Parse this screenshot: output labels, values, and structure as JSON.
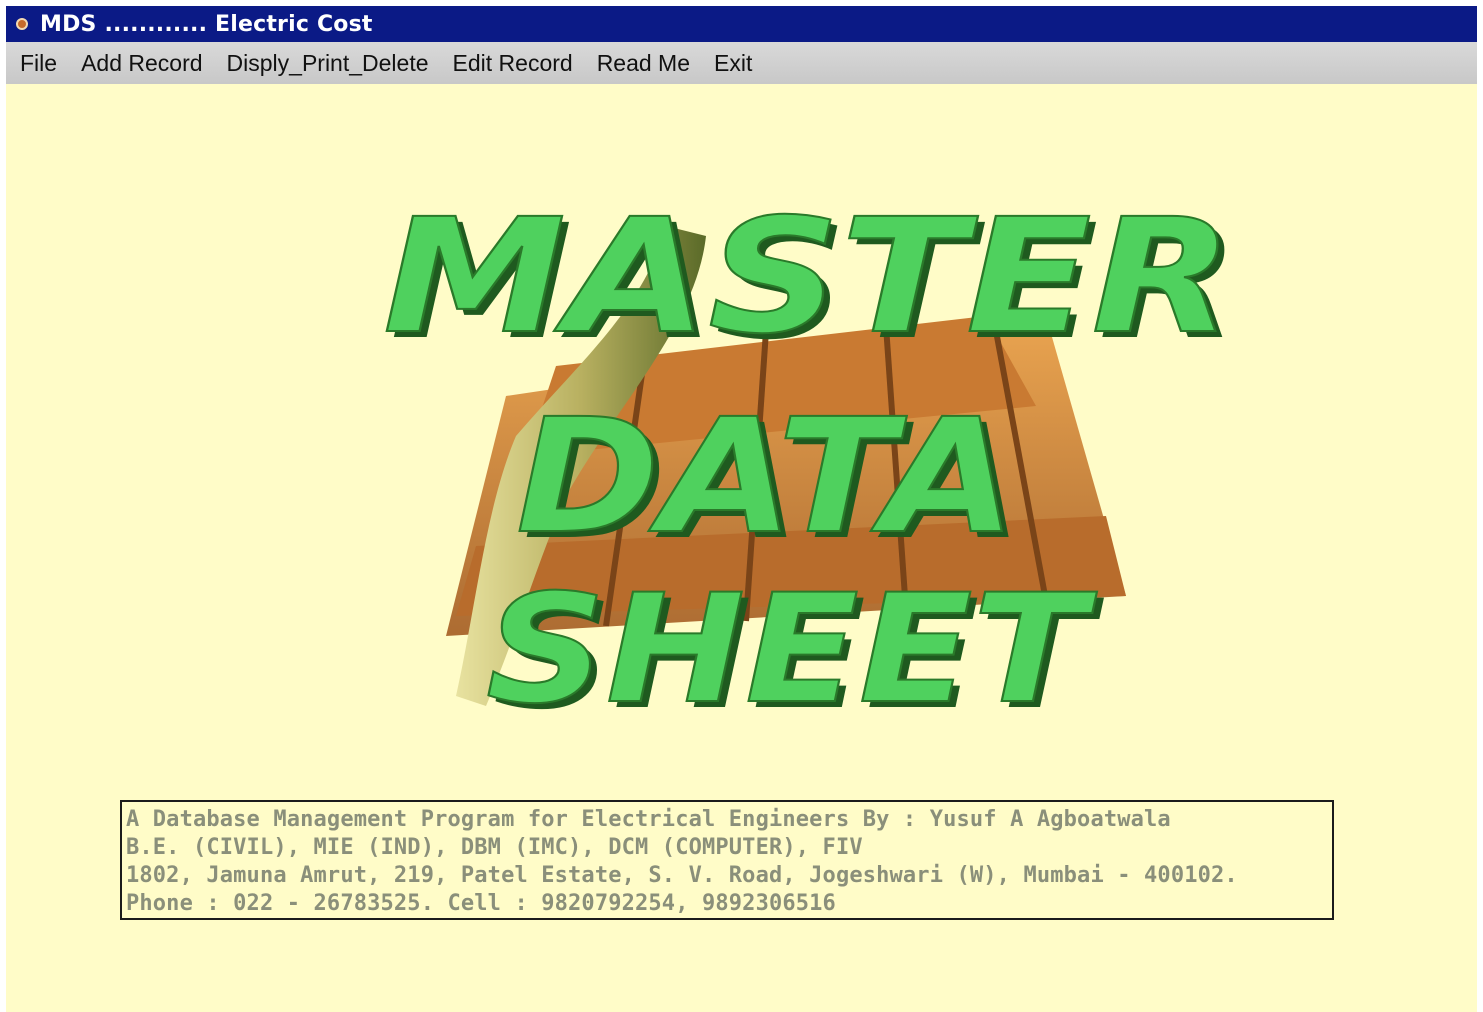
{
  "window": {
    "title": "MDS ............ Electric Cost",
    "icon": "app-icon"
  },
  "menu": {
    "items": [
      {
        "label": "File"
      },
      {
        "label": "Add Record"
      },
      {
        "label": "Disply_Print_Delete"
      },
      {
        "label": "Edit Record"
      },
      {
        "label": "Read Me"
      },
      {
        "label": "Exit"
      }
    ]
  },
  "logo": {
    "line1": "MASTER",
    "line2": "DATA",
    "line3": "SHEET",
    "colors": {
      "letter_face": "#4fd15e",
      "letter_shadow": "#1f5a1f",
      "slab": "#d98a3a",
      "slab_dark": "#9a5a22",
      "highlight": "#e8e0a0"
    }
  },
  "info": {
    "line1": "A Database Management Program for Electrical Engineers By : Yusuf A Agboatwala",
    "line2": "B.E. (CIVIL), MIE (IND), DBM (IMC), DCM (COMPUTER), FIV",
    "line3": "1802, Jamuna Amrut, 219, Patel Estate, S. V. Road, Jogeshwari (W), Mumbai - 400102.",
    "line4": "Phone : 022 - 26783525. Cell : 9820792254, 9892306516"
  },
  "colors": {
    "titlebar": "#0b1a86",
    "background": "#fffcc8",
    "menubar": "#d0d0d0",
    "info_text": "#8a8f7a"
  }
}
